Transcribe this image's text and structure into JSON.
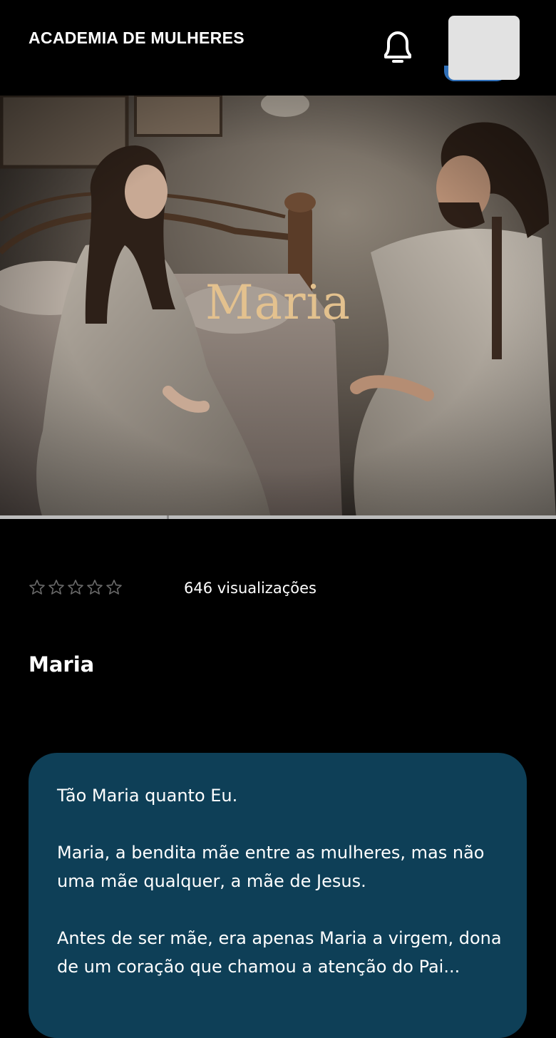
{
  "header": {
    "brand": "ACADEMIA DE MULHERES",
    "bell_icon": "bell-icon",
    "avatar": "user-avatar"
  },
  "hero": {
    "title": "Maria",
    "image": "illustration of a young woman and a bearded man in white robes sitting facing each other by a bed"
  },
  "video": {
    "progress": 0.3
  },
  "stats": {
    "rating_max": 5,
    "rating_value": 0,
    "views": "646 visualizações"
  },
  "content": {
    "title": "Maria",
    "paragraphs": [
      "Tão Maria quanto Eu.",
      "Maria, a bendita mãe entre as mulheres, mas não uma mãe qualquer, a mãe de Jesus.",
      "Antes de ser mãe, era apenas Maria a virgem, dona de um coração que chamou a atenção do Pai..."
    ]
  },
  "colors": {
    "background": "#000000",
    "card": "#0e3f57",
    "hero_title": "#e3c18e",
    "star_outline": "#6b6b6b"
  }
}
